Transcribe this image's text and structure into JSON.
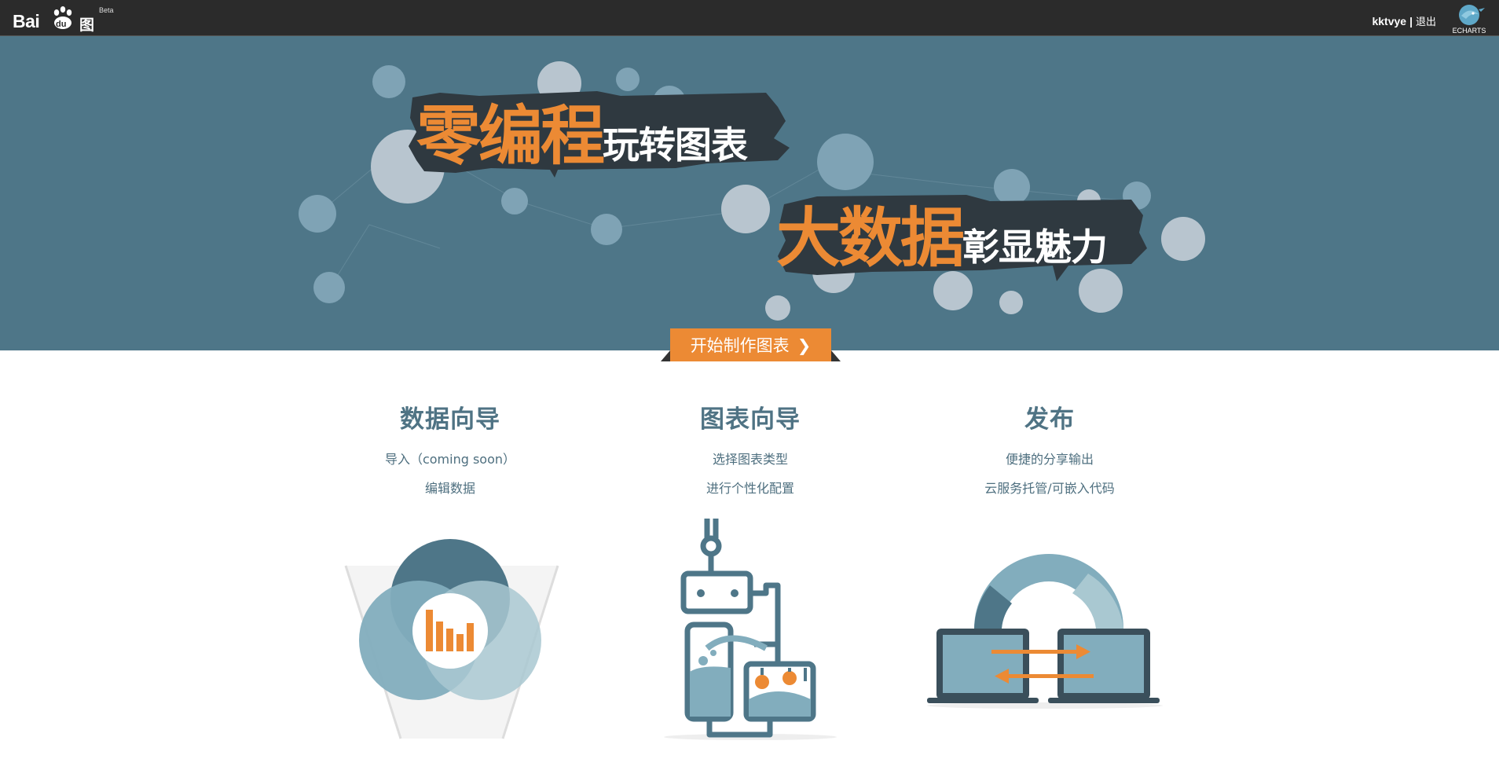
{
  "header": {
    "logo_text": "Bai",
    "logo_du": "du",
    "logo_product": "图说",
    "logo_badge": "Beta",
    "username": "kktvye",
    "separator": "|",
    "logout_label": "退出",
    "echarts_label": "ECHARTS"
  },
  "hero": {
    "line1_highlight": "零编程",
    "line1_rest": "玩转图表",
    "line2_highlight": "大数据",
    "line2_rest": "彰显魅力",
    "cta_label": "开始制作图表",
    "cta_arrow": "❯"
  },
  "features": [
    {
      "title": "数据向导",
      "line1": "导入（coming soon）",
      "line2": "编辑数据"
    },
    {
      "title": "图表向导",
      "line1": "选择图表类型",
      "line2": "进行个性化配置"
    },
    {
      "title": "发布",
      "line1": "便捷的分享输出",
      "line2": "云服务托管/可嵌入代码"
    }
  ],
  "colors": {
    "topbar": "#2b2b2b",
    "hero_bg": "#4e7688",
    "accent_orange": "#ec8a34",
    "title_teal": "#4f7384"
  }
}
